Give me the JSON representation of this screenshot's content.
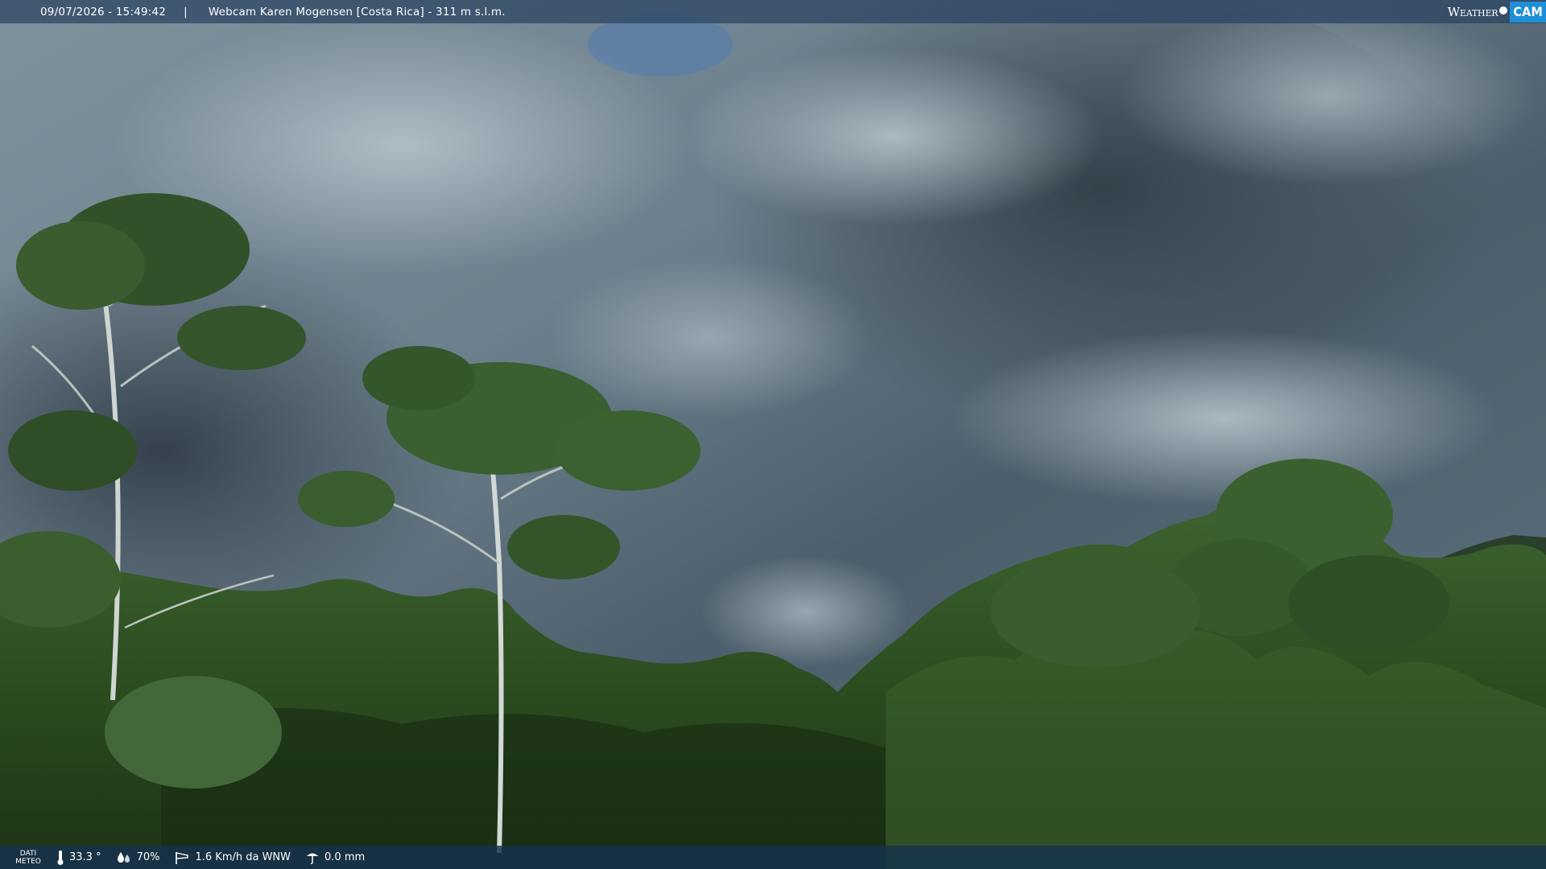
{
  "overlay": {
    "datetime": "09/07/2026 - 15:49:42",
    "separator": "|",
    "title": "Webcam Karen Mogensen [Costa Rica]  - 311 m s.l.m.",
    "brand_weather": "Weather",
    "brand_cam": "CAM"
  },
  "weather_bar": {
    "label_line1": "DATI",
    "label_line2": "METEO",
    "temperature": "33.3 °",
    "humidity": "70%",
    "wind": "1.6 Km/h da WNW",
    "rain": "0.0 mm",
    "icons": {
      "temperature": "thermometer-icon",
      "humidity": "humidity-drops-icon",
      "wind": "wind-windsock-icon",
      "rain": "rain-gauge-icon"
    }
  },
  "colors": {
    "brand_cam_bg": "#1e8fd6",
    "bar_bg": "#163249",
    "sky_dark": "#3d4f5c",
    "foliage": "#2a4a1e"
  }
}
